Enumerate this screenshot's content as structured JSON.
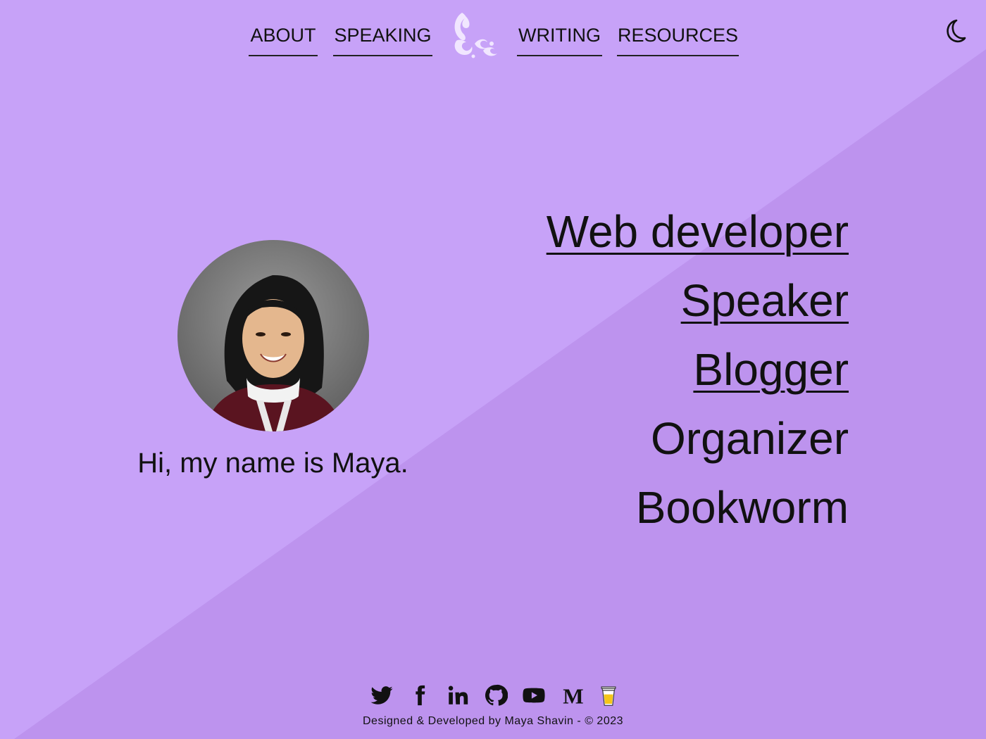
{
  "colors": {
    "background_light": "#c7a2f8",
    "background_dark": "#bd93ee",
    "text": "#111111",
    "logo": "#f1e6ff"
  },
  "nav": {
    "items": [
      {
        "label": "ABOUT"
      },
      {
        "label": "SPEAKING"
      },
      {
        "label": "WRITING"
      },
      {
        "label": "RESOURCES"
      }
    ],
    "logo_icon": "swirl-logo-icon",
    "theme_toggle_icon": "moon-icon"
  },
  "hero": {
    "greeting": "Hi, my name is Maya.",
    "avatar_icon": "profile-photo",
    "roles": [
      {
        "label": "Web developer",
        "linked": true
      },
      {
        "label": "Speaker",
        "linked": true
      },
      {
        "label": "Blogger",
        "linked": true
      },
      {
        "label": "Organizer",
        "linked": false
      },
      {
        "label": "Bookworm",
        "linked": false
      }
    ]
  },
  "footer": {
    "social_icons": [
      "twitter-icon",
      "facebook-icon",
      "linkedin-icon",
      "github-icon",
      "youtube-icon",
      "medium-icon",
      "buy-me-a-coffee-icon"
    ],
    "credits_prefix": "Designed & Developed by",
    "credits_name": "Maya Shavin",
    "credits_separator": "-",
    "credits_copyright": "© 2023"
  }
}
